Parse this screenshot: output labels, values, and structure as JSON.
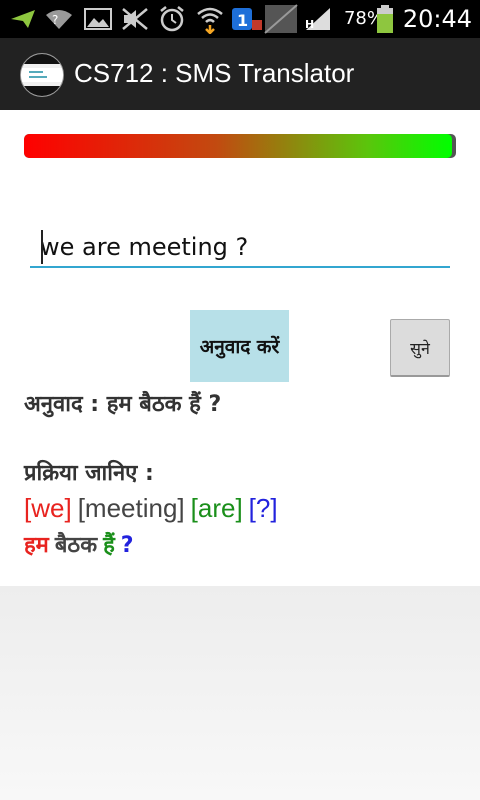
{
  "status_bar": {
    "battery_percent": "78%",
    "time": "20:44",
    "icons": [
      "send-icon",
      "wifi-icon",
      "image-icon",
      "silent-icon",
      "alarm-icon",
      "wifi-signal-icon",
      "download-icon",
      "image-placeholder-icon",
      "signal-icon",
      "battery-icon"
    ]
  },
  "action_bar": {
    "title": "CS712 : SMS Translator",
    "icon": "app-icon"
  },
  "meter": {
    "fill_fraction": 0.99
  },
  "input": {
    "value": "we are meeting ?"
  },
  "buttons": {
    "translate": "अनुवाद करें",
    "listen": "सुने"
  },
  "result": {
    "label": "अनुवाद :",
    "text": "हम बैठक हैं ?"
  },
  "process": {
    "heading": "प्रक्रिया जानिए :",
    "tokens": [
      {
        "text": "[we]",
        "color": "#e8231f"
      },
      {
        "text": "[meeting]",
        "color": "#444444"
      },
      {
        "text": "[are]",
        "color": "#1a8f1a"
      },
      {
        "text": "[?]",
        "color": "#2222dd"
      }
    ],
    "hindi": [
      {
        "text": "हम",
        "color": "#e8231f"
      },
      {
        "text": "बैठक",
        "color": "#444444"
      },
      {
        "text": "हैं",
        "color": "#1a8f1a"
      },
      {
        "text": "?",
        "color": "#2222dd"
      }
    ]
  }
}
